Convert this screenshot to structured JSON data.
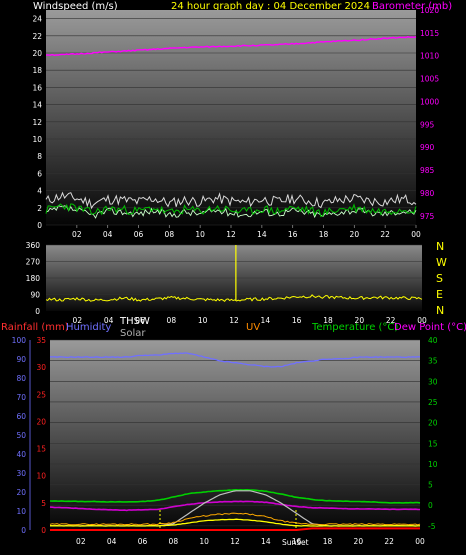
{
  "header": {
    "windspeed_label": "Windspeed (m/s)",
    "date_title": "24 hour graph day : 04 December 2024",
    "barometer_label": "Barometer (mb)"
  },
  "middle": {
    "compass": [
      "N",
      "W",
      "S",
      "E",
      "N"
    ]
  },
  "bottom_header": {
    "rainfall_label": "Rainfall (mm)",
    "humidity_label": "Humidity",
    "thsw_label": "THSW",
    "solar_label": "Solar",
    "uv_label": "UV",
    "temperature_label": "Temperature (°C)",
    "dewpoint_label": "Dew Point (°C)"
  },
  "sun_labels": {
    "sunrise": "",
    "sunset": "SunSet"
  },
  "colors": {
    "windspeed": "#ffffff",
    "gust": "#d9d9d9",
    "wind_avg": "#00c000",
    "barometer": "#ff00ff",
    "direction": "#ffff00",
    "humidity": "#7070ff",
    "temperature": "#00d000",
    "dewpoint": "#d000d0",
    "solar": "#c0c0c0",
    "thsw": "#ffffff",
    "uv": "#ffff00",
    "rain": "#ff0000",
    "sunrise_marker": "#ffff00"
  },
  "chart_data": [
    {
      "type": "line",
      "title": "24 hour graph day : 04 December 2024",
      "xlabel": "",
      "x_ticks": [
        "02",
        "04",
        "06",
        "08",
        "10",
        "12",
        "14",
        "16",
        "18",
        "20",
        "22",
        "00"
      ],
      "y_left": {
        "label": "Windspeed (m/s)",
        "ticks": [
          0,
          2,
          4,
          6,
          8,
          10,
          12,
          14,
          16,
          18,
          20,
          22,
          24
        ],
        "range": [
          0,
          25
        ]
      },
      "y_right": {
        "label": "Barometer (mb)",
        "ticks": [
          975,
          980,
          985,
          990,
          995,
          1000,
          1005,
          1010,
          1015,
          1020
        ],
        "range": [
          973,
          1020
        ]
      },
      "series": [
        {
          "name": "Windspeed (m/s)",
          "axis": "left",
          "values": [
            2.3,
            2.9,
            2.6,
            2.0,
            2.5,
            2.4,
            2.2,
            2.6,
            2.0,
            2.4,
            2.2,
            2.6,
            2.3,
            2.1,
            2.5,
            2.2,
            2.6,
            2.3,
            2.0,
            2.4,
            2.6,
            2.3,
            2.2,
            2.5,
            2.4
          ]
        },
        {
          "name": "Barometer (mb)",
          "axis": "right",
          "values": [
            1010.2,
            1010.2,
            1010.4,
            1010.6,
            1010.8,
            1011.0,
            1011.2,
            1011.4,
            1011.6,
            1011.8,
            1011.9,
            1012.0,
            1012.1,
            1012.2,
            1012.3,
            1012.4,
            1012.6,
            1012.8,
            1013.0,
            1013.2,
            1013.4,
            1013.6,
            1013.8,
            1014.0,
            1014.1
          ]
        }
      ]
    },
    {
      "type": "line",
      "title": "",
      "x_ticks": [
        "02",
        "04",
        "06",
        "08",
        "10",
        "12",
        "14",
        "16",
        "18",
        "20",
        "22",
        "00"
      ],
      "y_left": {
        "label": "",
        "ticks": [
          0,
          45,
          90,
          135,
          180,
          225,
          270,
          315,
          360
        ],
        "range": [
          0,
          360
        ]
      },
      "series": [
        {
          "name": "",
          "values": [
            65,
            60,
            68,
            58,
            62,
            70,
            60,
            65,
            72,
            68,
            62,
            60,
            58,
            63,
            66,
            70,
            78,
            80,
            76,
            72,
            70,
            74,
            72,
            70,
            68
          ]
        }
      ]
    },
    {
      "type": "line",
      "title": "",
      "x_ticks": [
        "02",
        "04",
        "06",
        "08",
        "10",
        "12",
        "14",
        "16",
        "18",
        "20",
        "22",
        "00"
      ],
      "y_left": {
        "label": "Humidity",
        "ticks": [
          0,
          10,
          20,
          30,
          40,
          50,
          60,
          70,
          80,
          90,
          100
        ],
        "range": [
          0,
          100
        ]
      },
      "y_rain": {
        "label": "Rainfall (mm)",
        "ticks": [
          0,
          5,
          10,
          15,
          20,
          25,
          30,
          35
        ],
        "range": [
          0,
          35
        ]
      },
      "y_right": {
        "label": "Temperature (°C)",
        "ticks": [
          -5,
          0,
          5,
          10,
          15,
          20,
          25,
          30,
          35,
          40
        ],
        "range": [
          -6,
          40
        ]
      },
      "series": [
        {
          "name": "Humidity",
          "axis": "left",
          "values": [
            91,
            91,
            91,
            91,
            91,
            91,
            92,
            92,
            93,
            93,
            91,
            89,
            88,
            87,
            86,
            86,
            88,
            89,
            90,
            90,
            91,
            91,
            91,
            91,
            91
          ]
        },
        {
          "name": "Temperature (°C)",
          "axis": "right",
          "values": [
            1.0,
            1.0,
            0.9,
            0.9,
            0.8,
            0.8,
            0.9,
            1.2,
            2.0,
            2.8,
            3.2,
            3.5,
            3.7,
            3.7,
            3.4,
            2.7,
            1.9,
            1.4,
            1.1,
            1.0,
            0.9,
            0.8,
            0.6,
            0.6,
            0.6
          ]
        },
        {
          "name": "Dew Point (°C)",
          "axis": "right",
          "values": [
            -0.5,
            -0.6,
            -0.8,
            -1.0,
            -1.1,
            -1.2,
            -1.1,
            -1.0,
            -0.4,
            0.2,
            0.6,
            0.8,
            0.9,
            0.9,
            0.7,
            0.2,
            -0.3,
            -0.6,
            -0.7,
            -0.8,
            -0.9,
            -0.9,
            -1.0,
            -1.0,
            -1.0
          ]
        },
        {
          "name": "Solar",
          "axis": "right",
          "values": [
            -5,
            -5,
            -5,
            -5,
            -5,
            -5,
            -5,
            -5,
            -4.5,
            -2,
            0.5,
            2.5,
            3.5,
            3.5,
            2.5,
            0.5,
            -2,
            -4.5,
            -5,
            -5,
            -5,
            -5,
            -5,
            -5,
            -5
          ]
        },
        {
          "name": "THSW",
          "axis": "right",
          "values": [
            -4.6,
            -4.6,
            -4.6,
            -4.6,
            -4.6,
            -4.6,
            -4.6,
            -4.6,
            -4.2,
            -3.2,
            -2.6,
            -2.2,
            -2.0,
            -2.2,
            -2.8,
            -3.8,
            -4.4,
            -4.6,
            -4.6,
            -4.6,
            -4.6,
            -4.6,
            -4.6,
            -4.6,
            -4.6
          ]
        },
        {
          "name": "UV",
          "axis": "right",
          "values": [
            -5.0,
            -5.0,
            -5.0,
            -5.0,
            -5.0,
            -5.0,
            -5.0,
            -5.0,
            -4.8,
            -4.3,
            -3.8,
            -3.5,
            -3.4,
            -3.6,
            -4.0,
            -4.6,
            -5.0,
            -5.0,
            -5.0,
            -5.0,
            -5.0,
            -5.0,
            -5.0,
            -5.0,
            -5.0
          ]
        },
        {
          "name": "Rainfall (mm)",
          "axis": "rain",
          "values": [
            0,
            0,
            0,
            0,
            0,
            0,
            0,
            0,
            0,
            0,
            0,
            0,
            0,
            0,
            0,
            0,
            0,
            0.3,
            0.3,
            0.3,
            0.3,
            0.3,
            0.3,
            0.3,
            0.3
          ]
        }
      ]
    }
  ]
}
